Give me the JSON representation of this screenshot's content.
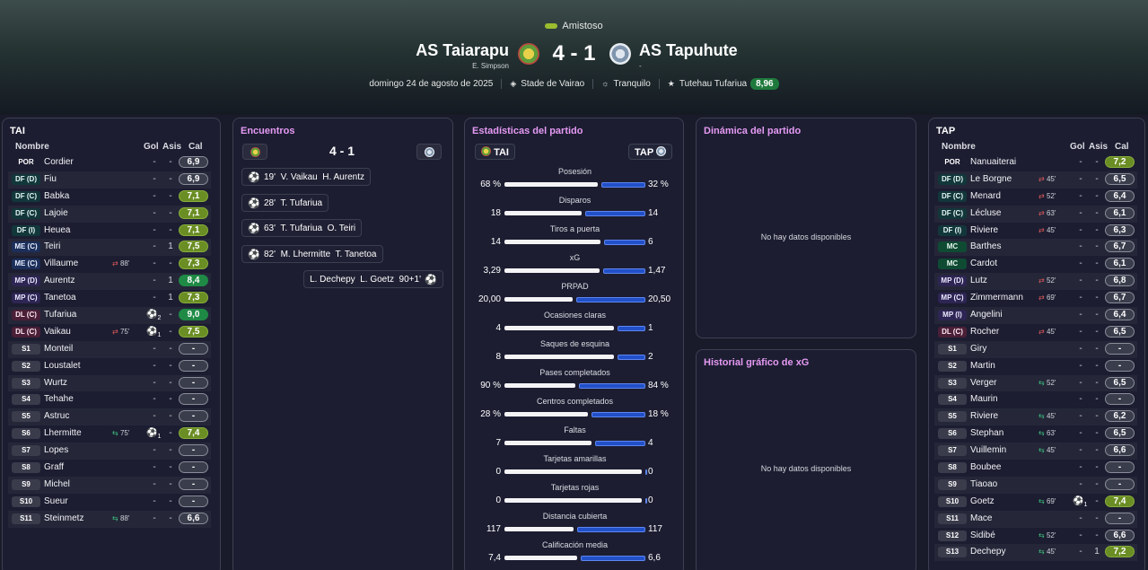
{
  "match": {
    "competition": "Amistoso",
    "home": {
      "name": "AS Taiarapu",
      "coach": "E. Simpson",
      "abbr": "TAI"
    },
    "away": {
      "name": "AS Tapuhute",
      "coach": "-",
      "abbr": "TAP"
    },
    "score": "4 - 1",
    "date": "domingo 24 de agosto de 2025",
    "stadium": "Stade de Vairao",
    "weather": "Tranquilo",
    "potm": "Tutehau Tufariua",
    "potm_rating": "8,96"
  },
  "colors": {
    "rating_high": "#2e8b46",
    "rating_good": "#7a9a2a",
    "rating_mid": "#3a3d4c",
    "away_bar": "#2150c8",
    "accent_title": "#e59af3"
  },
  "columns": {
    "name": "Nombre",
    "goals": "Gol",
    "assists": "Asis",
    "rating": "Cal"
  },
  "home_players": [
    {
      "pos": "POR",
      "name": "Cordier",
      "sub": "",
      "g": "-",
      "a": "-",
      "r": "6,9"
    },
    {
      "pos": "DF (D)",
      "name": "Fiu",
      "sub": "",
      "g": "-",
      "a": "-",
      "r": "6,9"
    },
    {
      "pos": "DF (C)",
      "name": "Babka",
      "sub": "",
      "g": "-",
      "a": "-",
      "r": "7,1"
    },
    {
      "pos": "DF (C)",
      "name": "Lajoie",
      "sub": "",
      "g": "-",
      "a": "-",
      "r": "7,1"
    },
    {
      "pos": "DF (I)",
      "name": "Heuea",
      "sub": "",
      "g": "-",
      "a": "-",
      "r": "7,1"
    },
    {
      "pos": "ME (C)",
      "name": "Teiri",
      "sub": "",
      "g": "-",
      "a": "1",
      "r": "7,5"
    },
    {
      "pos": "ME (C)",
      "name": "Villaume",
      "sub": "88'",
      "subtype": "out",
      "g": "-",
      "a": "-",
      "r": "7,3"
    },
    {
      "pos": "MP (D)",
      "name": "Aurentz",
      "sub": "",
      "g": "-",
      "a": "1",
      "r": "8,4"
    },
    {
      "pos": "MP (C)",
      "name": "Tanetoa",
      "sub": "",
      "g": "-",
      "a": "1",
      "r": "7,3"
    },
    {
      "pos": "DL (C)",
      "name": "Tufariua",
      "sub": "",
      "goals_icon": "2",
      "g": "",
      "a": "-",
      "r": "9,0"
    },
    {
      "pos": "DL (C)",
      "name": "Vaikau",
      "sub": "75'",
      "subtype": "out",
      "goals_icon": "1",
      "g": "",
      "a": "-",
      "r": "7,5"
    },
    {
      "pos": "S1",
      "name": "Monteil",
      "sub": "",
      "g": "-",
      "a": "-",
      "r": "-"
    },
    {
      "pos": "S2",
      "name": "Loustalet",
      "sub": "",
      "g": "-",
      "a": "-",
      "r": "-"
    },
    {
      "pos": "S3",
      "name": "Wurtz",
      "sub": "",
      "g": "-",
      "a": "-",
      "r": "-"
    },
    {
      "pos": "S4",
      "name": "Tehahe",
      "sub": "",
      "g": "-",
      "a": "-",
      "r": "-"
    },
    {
      "pos": "S5",
      "name": "Astruc",
      "sub": "",
      "g": "-",
      "a": "-",
      "r": "-"
    },
    {
      "pos": "S6",
      "name": "Lhermitte",
      "sub": "75'",
      "subtype": "in",
      "goals_icon": "1",
      "g": "",
      "a": "-",
      "r": "7,4"
    },
    {
      "pos": "S7",
      "name": "Lopes",
      "sub": "",
      "g": "-",
      "a": "-",
      "r": "-"
    },
    {
      "pos": "S8",
      "name": "Graff",
      "sub": "",
      "g": "-",
      "a": "-",
      "r": "-"
    },
    {
      "pos": "S9",
      "name": "Michel",
      "sub": "",
      "g": "-",
      "a": "-",
      "r": "-"
    },
    {
      "pos": "S10",
      "name": "Sueur",
      "sub": "",
      "g": "-",
      "a": "-",
      "r": "-"
    },
    {
      "pos": "S11",
      "name": "Steinmetz",
      "sub": "88'",
      "subtype": "in",
      "g": "-",
      "a": "-",
      "r": "6,6"
    }
  ],
  "away_players": [
    {
      "pos": "POR",
      "name": "Nanuaiterai",
      "sub": "",
      "g": "-",
      "a": "-",
      "r": "7,2"
    },
    {
      "pos": "DF (D)",
      "name": "Le Borgne",
      "sub": "45'",
      "subtype": "out",
      "g": "-",
      "a": "-",
      "r": "6,5"
    },
    {
      "pos": "DF (C)",
      "name": "Menard",
      "sub": "52'",
      "subtype": "out",
      "g": "-",
      "a": "-",
      "r": "6,4"
    },
    {
      "pos": "DF (C)",
      "name": "Lécluse",
      "sub": "63'",
      "subtype": "out",
      "g": "-",
      "a": "-",
      "r": "6,1"
    },
    {
      "pos": "DF (I)",
      "name": "Riviere",
      "sub": "45'",
      "subtype": "out",
      "g": "-",
      "a": "-",
      "r": "6,3"
    },
    {
      "pos": "MC",
      "name": "Barthes",
      "sub": "",
      "g": "-",
      "a": "-",
      "r": "6,7"
    },
    {
      "pos": "MC",
      "name": "Cardot",
      "sub": "",
      "g": "-",
      "a": "-",
      "r": "6,1"
    },
    {
      "pos": "MP (D)",
      "name": "Lutz",
      "sub": "52'",
      "subtype": "out",
      "g": "-",
      "a": "-",
      "r": "6,8"
    },
    {
      "pos": "MP (C)",
      "name": "Zimmermann",
      "sub": "69'",
      "subtype": "out",
      "g": "-",
      "a": "-",
      "r": "6,7"
    },
    {
      "pos": "MP (I)",
      "name": "Angelini",
      "sub": "",
      "g": "-",
      "a": "-",
      "r": "6,4"
    },
    {
      "pos": "DL (C)",
      "name": "Rocher",
      "sub": "45'",
      "subtype": "out",
      "g": "-",
      "a": "-",
      "r": "6,5"
    },
    {
      "pos": "S1",
      "name": "Giry",
      "sub": "",
      "g": "-",
      "a": "-",
      "r": "-"
    },
    {
      "pos": "S2",
      "name": "Martin",
      "sub": "",
      "g": "-",
      "a": "-",
      "r": "-"
    },
    {
      "pos": "S3",
      "name": "Verger",
      "sub": "52'",
      "subtype": "in",
      "g": "-",
      "a": "-",
      "r": "6,5"
    },
    {
      "pos": "S4",
      "name": "Maurin",
      "sub": "",
      "g": "-",
      "a": "-",
      "r": "-"
    },
    {
      "pos": "S5",
      "name": "Riviere",
      "sub": "45'",
      "subtype": "in",
      "g": "-",
      "a": "-",
      "r": "6,2"
    },
    {
      "pos": "S6",
      "name": "Stephan",
      "sub": "63'",
      "subtype": "in",
      "g": "-",
      "a": "-",
      "r": "6,5"
    },
    {
      "pos": "S7",
      "name": "Vuillemin",
      "sub": "45'",
      "subtype": "in",
      "g": "-",
      "a": "-",
      "r": "6,6"
    },
    {
      "pos": "S8",
      "name": "Boubee",
      "sub": "",
      "g": "-",
      "a": "-",
      "r": "-"
    },
    {
      "pos": "S9",
      "name": "Tiaoao",
      "sub": "",
      "g": "-",
      "a": "-",
      "r": "-"
    },
    {
      "pos": "S10",
      "name": "Goetz",
      "sub": "69'",
      "subtype": "in",
      "goals_icon": "1",
      "g": "",
      "a": "-",
      "r": "7,4"
    },
    {
      "pos": "S11",
      "name": "Mace",
      "sub": "",
      "g": "-",
      "a": "-",
      "r": "-"
    },
    {
      "pos": "S12",
      "name": "Sidibé",
      "sub": "52'",
      "subtype": "in",
      "g": "-",
      "a": "-",
      "r": "6,6"
    },
    {
      "pos": "S13",
      "name": "Dechepy",
      "sub": "45'",
      "subtype": "in",
      "g": "-",
      "a": "1",
      "r": "7,2"
    }
  ],
  "panels": {
    "home_title": "TAI",
    "away_title": "TAP",
    "encounters_title": "Encuentros",
    "stats_title": "Estadísticas del partido",
    "dynamics_title": "Dinámica del partido",
    "xg_title": "Historial gráfico de xG",
    "no_data": "No hay datos disponibles"
  },
  "goals": [
    {
      "text": "19'  V. Vaikau  H. Aurentz",
      "side": "home"
    },
    {
      "text": "28'  T. Tufariua",
      "side": "home"
    },
    {
      "text": "63'  T. Tufariua  O. Teiri",
      "side": "home"
    },
    {
      "text": "82'  M. Lhermitte  T. Tanetoa",
      "side": "home"
    },
    {
      "text": "L. Dechepy  L. Goetz  90+1'",
      "side": "away"
    }
  ],
  "stats": [
    {
      "label": "Posesión",
      "home": "68 %",
      "away": "32 %",
      "hv": 68,
      "av": 32
    },
    {
      "label": "Disparos",
      "home": "18",
      "away": "14",
      "hv": 18,
      "av": 14
    },
    {
      "label": "Tiros a puerta",
      "home": "14",
      "away": "6",
      "hv": 14,
      "av": 6
    },
    {
      "label": "xG",
      "home": "3,29",
      "away": "1,47",
      "hv": 3.29,
      "av": 1.47
    },
    {
      "label": "PRPAD",
      "home": "20,00",
      "away": "20,50",
      "hv": 20.0,
      "av": 20.5
    },
    {
      "label": "Ocasiones claras",
      "home": "4",
      "away": "1",
      "hv": 4,
      "av": 1
    },
    {
      "label": "Saques de esquina",
      "home": "8",
      "away": "2",
      "hv": 8,
      "av": 2
    },
    {
      "label": "Pases completados",
      "home": "90 %",
      "away": "84 %",
      "hv": 90,
      "av": 84
    },
    {
      "label": "Centros completados",
      "home": "28 %",
      "away": "18 %",
      "hv": 28,
      "av": 18
    },
    {
      "label": "Faltas",
      "home": "7",
      "away": "4",
      "hv": 7,
      "av": 4
    },
    {
      "label": "Tarjetas amarillas",
      "home": "0",
      "away": "0",
      "hv": 0,
      "av": 0
    },
    {
      "label": "Tarjetas rojas",
      "home": "0",
      "away": "0",
      "hv": 0,
      "av": 0
    },
    {
      "label": "Distancia cubierta",
      "home": "117",
      "away": "117",
      "hv": 117,
      "av": 117
    },
    {
      "label": "Calificación media",
      "home": "7,4",
      "away": "6,6",
      "hv": 7.4,
      "av": 6.6
    }
  ]
}
